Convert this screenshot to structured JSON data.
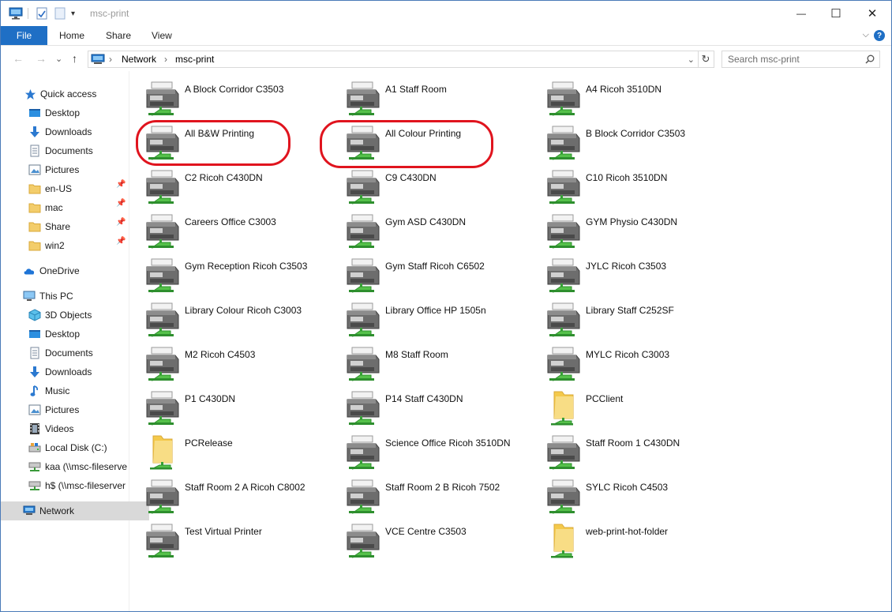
{
  "window": {
    "title": "msc-print",
    "minimize_glyph": "—",
    "maximize_glyph": "☐",
    "close_glyph": "✕"
  },
  "ribbon": {
    "file_tab": "File",
    "tabs": [
      "Home",
      "Share",
      "View"
    ],
    "expand_glyph": "⌵",
    "help_glyph": "?"
  },
  "address": {
    "back_glyph": "←",
    "forward_glyph": "→",
    "recent_glyph": "⌄",
    "up_glyph": "↑",
    "crumbs": [
      "Network",
      "msc-print"
    ],
    "crumb_sep": "›",
    "dropdown_glyph": "⌄",
    "refresh_glyph": "↻",
    "search_placeholder": "Search msc-print"
  },
  "nav": {
    "quick_access": "Quick access",
    "quick_items": [
      "Desktop",
      "Downloads",
      "Documents",
      "Pictures",
      "en-US",
      "mac",
      "Share",
      "win2"
    ],
    "onedrive": "OneDrive",
    "this_pc": "This PC",
    "pc_items": [
      "3D Objects",
      "Desktop",
      "Documents",
      "Downloads",
      "Music",
      "Pictures",
      "Videos",
      "Local Disk (C:)",
      "kaa (\\\\msc-fileserve",
      "h$ (\\\\msc-fileserver"
    ],
    "network": "Network"
  },
  "items": [
    {
      "name": "A Block Corridor C3503",
      "icon": "printer-icon"
    },
    {
      "name": "A1 Staff Room",
      "icon": "printer-icon"
    },
    {
      "name": "A4 Ricoh 3510DN",
      "icon": "printer-icon"
    },
    {
      "name": "All B&W Printing",
      "icon": "printer-icon"
    },
    {
      "name": "All Colour Printing",
      "icon": "printer-icon"
    },
    {
      "name": "B Block Corridor C3503",
      "icon": "printer-icon"
    },
    {
      "name": "C2 Ricoh C430DN",
      "icon": "printer-icon"
    },
    {
      "name": "C9 C430DN",
      "icon": "printer-icon"
    },
    {
      "name": "C10 Ricoh 3510DN",
      "icon": "printer-icon"
    },
    {
      "name": "Careers Office C3003",
      "icon": "printer-icon"
    },
    {
      "name": "Gym ASD C430DN",
      "icon": "printer-icon"
    },
    {
      "name": "GYM Physio C430DN",
      "icon": "printer-icon"
    },
    {
      "name": "Gym Reception Ricoh C3503",
      "icon": "printer-icon"
    },
    {
      "name": "Gym Staff Ricoh C6502",
      "icon": "printer-icon"
    },
    {
      "name": "JYLC Ricoh C3503",
      "icon": "printer-icon"
    },
    {
      "name": "Library Colour Ricoh C3003",
      "icon": "printer-icon"
    },
    {
      "name": "Library Office HP 1505n",
      "icon": "printer-icon"
    },
    {
      "name": "Library Staff C252SF",
      "icon": "printer-icon"
    },
    {
      "name": "M2 Ricoh C4503",
      "icon": "printer-icon"
    },
    {
      "name": "M8 Staff Room",
      "icon": "printer-icon"
    },
    {
      "name": "MYLC Ricoh C3003",
      "icon": "printer-icon"
    },
    {
      "name": "P1 C430DN",
      "icon": "printer-icon"
    },
    {
      "name": "P14 Staff C430DN",
      "icon": "printer-icon"
    },
    {
      "name": "PCClient",
      "icon": "shared-folder-icon"
    },
    {
      "name": "PCRelease",
      "icon": "shared-folder-icon"
    },
    {
      "name": "Science Office Ricoh 3510DN",
      "icon": "printer-icon"
    },
    {
      "name": "Staff Room 1 C430DN",
      "icon": "printer-icon"
    },
    {
      "name": "Staff Room 2 A Ricoh C8002",
      "icon": "printer-icon"
    },
    {
      "name": "Staff Room 2 B Ricoh 7502",
      "icon": "printer-icon"
    },
    {
      "name": "SYLC Ricoh C4503",
      "icon": "printer-icon"
    },
    {
      "name": "Test Virtual Printer",
      "icon": "printer-icon"
    },
    {
      "name": "VCE Centre C3503",
      "icon": "printer-icon"
    },
    {
      "name": "web-print-hot-folder",
      "icon": "shared-folder-icon"
    }
  ],
  "colors": {
    "accent": "#1f6fc5",
    "annotation": "#e0141e",
    "selected_nav": "#d9d9d9"
  }
}
